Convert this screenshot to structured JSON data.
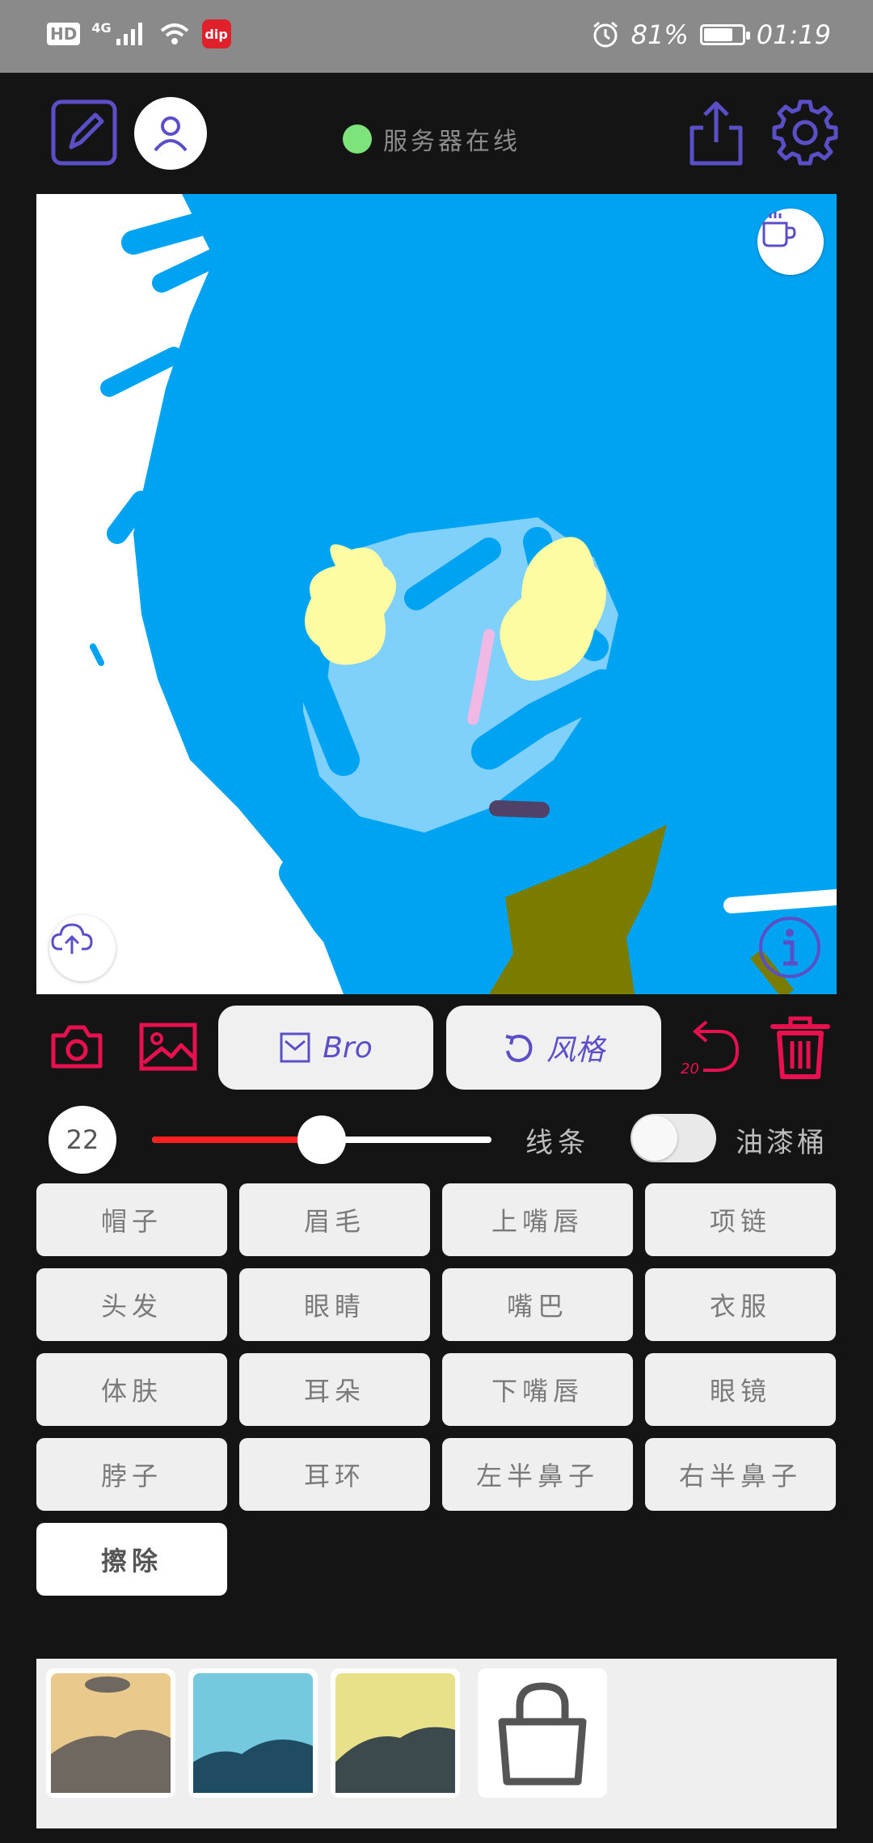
{
  "status_bar": {
    "hd": "HD",
    "network": "4G",
    "app_badge": "dip",
    "battery_percent": "81%",
    "battery_level": 0.81,
    "time": "01:19"
  },
  "header": {
    "server_status": "服务器在线",
    "server_status_color": "#7ee37a",
    "icons": [
      "edit-icon",
      "user-icon",
      "share-icon",
      "settings-icon"
    ]
  },
  "canvas": {
    "overlay_icons": [
      "coffee-cup-icon",
      "upload-cloud-icon",
      "info-icon"
    ]
  },
  "tools": {
    "bro_label": "Bro",
    "style_label": "风格",
    "undo_count": "20",
    "accent_color": "#e8104f",
    "brand_color": "#5b4fc7"
  },
  "brush": {
    "size": "22",
    "slider_value": 0.5,
    "line_label": "线条",
    "bucket_label": "油漆桶",
    "bucket_enabled": false
  },
  "parts": [
    {
      "label": "帽子"
    },
    {
      "label": "眉毛"
    },
    {
      "label": "上嘴唇"
    },
    {
      "label": "项链"
    },
    {
      "label": "头发"
    },
    {
      "label": "眼睛"
    },
    {
      "label": "嘴巴"
    },
    {
      "label": "衣服"
    },
    {
      "label": "体肤"
    },
    {
      "label": "耳朵"
    },
    {
      "label": "下嘴唇"
    },
    {
      "label": "眼镜"
    },
    {
      "label": "脖子"
    },
    {
      "label": "耳环"
    },
    {
      "label": "左半鼻子"
    },
    {
      "label": "右半鼻子"
    },
    {
      "label": "擦除",
      "active": true
    }
  ],
  "thumbnails": [
    {
      "tint": "#e9c98c",
      "shade": "#6f6860"
    },
    {
      "tint": "#74c9df",
      "shade": "#1f4b63"
    },
    {
      "tint": "#e9e08a",
      "shade": "#3d4a4d"
    }
  ],
  "shop_icon": "shopping-bag-icon"
}
